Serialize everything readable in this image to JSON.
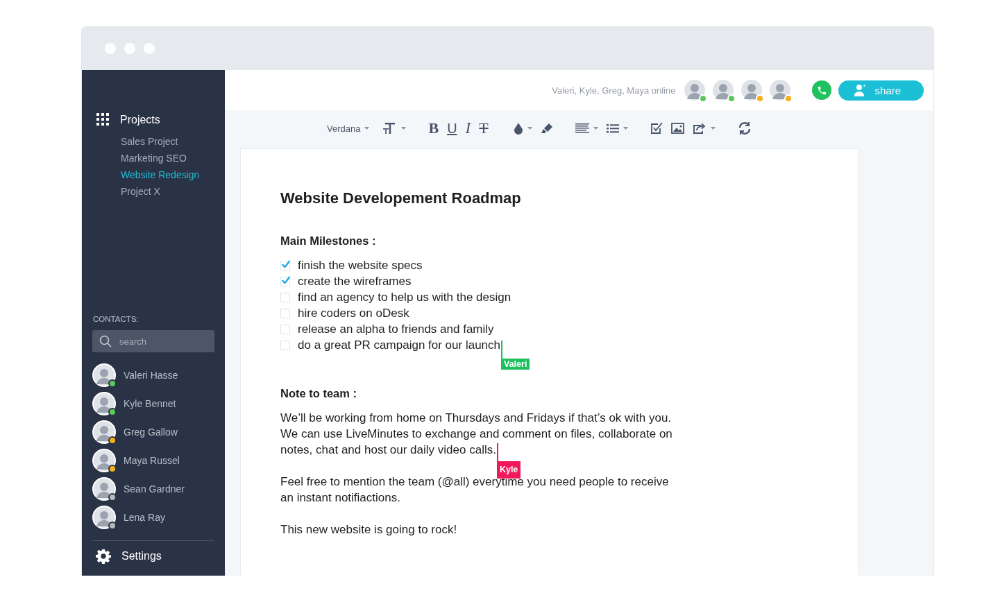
{
  "sidebar": {
    "projects": {
      "title": "Projects",
      "items": [
        {
          "label": "Sales Project",
          "selected": false
        },
        {
          "label": "Marketing SEO",
          "selected": false
        },
        {
          "label": "Website Redesign",
          "selected": true
        },
        {
          "label": "Project X",
          "selected": false
        }
      ]
    },
    "contacts": {
      "title": "CONTACTS:",
      "search": {
        "placeholder": "search"
      },
      "people": [
        {
          "name": "Valeri Hasse",
          "color": "#5ac85a"
        },
        {
          "name": "Kyle Bennet",
          "color": "#5ac85a"
        },
        {
          "name": "Greg Gallow",
          "color": "#f5b01a"
        },
        {
          "name": "Maya Russel",
          "color": "#f5b01a"
        },
        {
          "name": "Sean Gardner",
          "color": "#b4b8bf"
        },
        {
          "name": "Lena Ray",
          "color": "#b4b8bf"
        }
      ]
    },
    "settings": "Settings"
  },
  "header": {
    "online_text": "Valeri, Kyle, Greg, Maya online",
    "avatars": [
      {
        "color": "#5ac85a"
      },
      {
        "color": "#5ac85a"
      },
      {
        "color": "#f5b01a"
      },
      {
        "color": "#f5b01a"
      }
    ],
    "share": "share"
  },
  "toolbar": [
    {
      "kind": "font",
      "label": "Verdana",
      "dropdown": true
    },
    {
      "kind": "text-size",
      "dropdown": true
    },
    {
      "kind": "bold",
      "label": "B",
      "dropdown": false
    },
    {
      "kind": "underline",
      "label": "U",
      "dropdown": false
    },
    {
      "kind": "italic",
      "label": "I",
      "dropdown": false
    },
    {
      "kind": "strike",
      "label": "T",
      "dropdown": false
    },
    {
      "kind": "color",
      "dropdown": true
    },
    {
      "kind": "highlight",
      "dropdown": false
    },
    {
      "kind": "align",
      "dropdown": true
    },
    {
      "kind": "list",
      "dropdown": true
    },
    {
      "kind": "checkbox",
      "dropdown": false
    },
    {
      "kind": "image",
      "dropdown": false
    },
    {
      "kind": "share",
      "dropdown": true
    },
    {
      "kind": "refresh",
      "dropdown": false
    }
  ],
  "document": {
    "title": "Website Developement Roadmap",
    "sections": [
      {
        "kind": "checklist",
        "heading": "Main Milestones :",
        "items": [
          {
            "text": "finish the website specs",
            "checked": true
          },
          {
            "text": "create the wireframes",
            "checked": true
          },
          {
            "text": "find an agency to help us with the design",
            "checked": false
          },
          {
            "text": "hire coders on oDesk",
            "checked": false
          },
          {
            "text": "release an alpha to friends and family",
            "checked": false
          },
          {
            "text": "do a great PR campaign for our launch",
            "checked": false,
            "cursor": {
              "name": "Valeri",
              "color": "#1dbf5e"
            }
          }
        ]
      },
      {
        "kind": "paragraphs",
        "heading": "Note to team :",
        "paragraphs": [
          {
            "lines": [
              "We’ll be working from home on Thursdays and Fridays if that’s ok with you.",
              "We can use LiveMinutes to exchange and comment on files, collaborate on",
              "notes, chat and host our daily video calls."
            ],
            "cursor": {
              "name": "Kyle",
              "color": "#f0195a"
            }
          },
          {
            "lines": [
              "Feel free to mention the team (@all) everytime you need people to receive",
              "an instant notifiactions."
            ]
          },
          {
            "lines": [
              "This new website is going to rock!"
            ]
          }
        ]
      }
    ]
  }
}
